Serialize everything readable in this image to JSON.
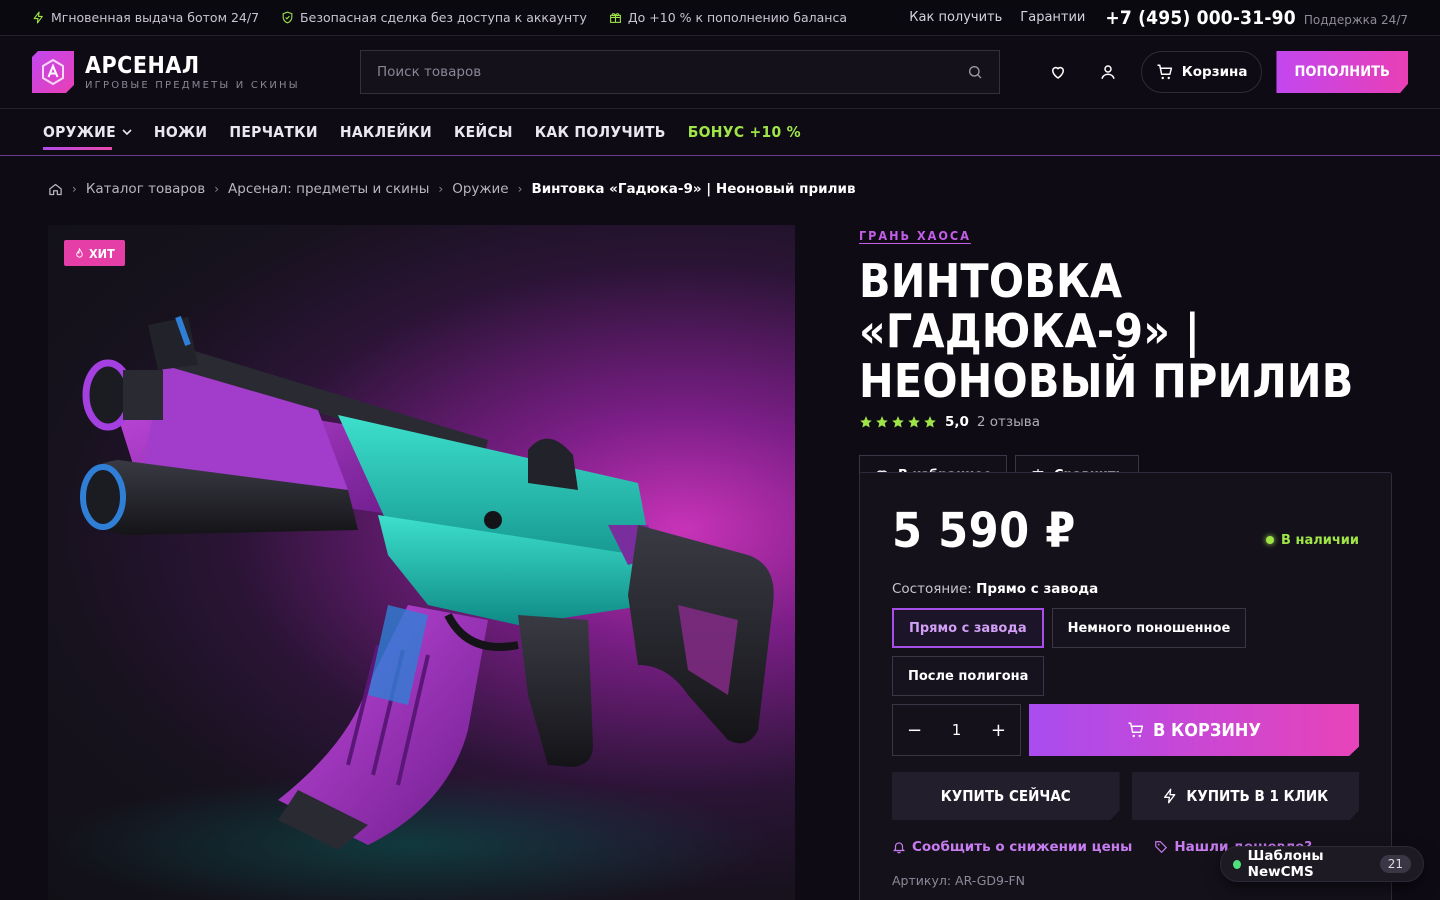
{
  "topbar": {
    "perks": [
      "Мгновенная выдача ботом 24/7",
      "Безопасная сделка без доступа к аккаунту",
      "До +10 % к пополнению баланса"
    ],
    "links": [
      "Как получить",
      "Гарантии"
    ],
    "phone": "+7 (495) 000-31-90",
    "support": "Поддержка 24/7"
  },
  "header": {
    "brand": "АРСЕНАЛ",
    "tagline": "ИГРОВЫЕ ПРЕДМЕТЫ И СКИНЫ",
    "search_placeholder": "Поиск товаров",
    "cart_label": "Корзина",
    "topup_label": "ПОПОЛНИТЬ"
  },
  "nav": {
    "items": [
      "ОРУЖИЕ",
      "НОЖИ",
      "ПЕРЧАТКИ",
      "НАКЛЕЙКИ",
      "КЕЙСЫ",
      "КАК ПОЛУЧИТЬ",
      "БОНУС +10 %"
    ]
  },
  "breadcrumb": [
    "Каталог товаров",
    "Арсенал: предметы и скины",
    "Оружие",
    "Винтовка «Гадюка-9» | Неоновый прилив"
  ],
  "product": {
    "badge": "ХИТ",
    "brand": "ГРАНЬ ХАОСА",
    "title": "ВИНТОВКА «ГАДЮКА-9» | НЕОНОВЫЙ ПРИЛИВ",
    "rating": "5,0",
    "reviews": "2 отзыва",
    "favorite_label": "В избранное",
    "compare_label": "Сравнить",
    "price": "5 590 ₽",
    "stock": "В наличии",
    "condition_label": "Состояние:",
    "condition_value": "Прямо с завода",
    "conditions": [
      "Прямо с завода",
      "Немного поношенное",
      "После полигона"
    ],
    "quantity": "1",
    "add_to_cart": "В КОРЗИНУ",
    "buy_now": "КУПИТЬ СЕЙЧАС",
    "one_click": "КУПИТЬ В 1 КЛИК",
    "price_alert": "Сообщить о снижении цены",
    "found_cheaper": "Нашли дешевле?",
    "sku": "Артикул: AR-GD9-FN"
  },
  "floating": {
    "label": "Шаблоны NewCMS",
    "count": "21"
  },
  "colors": {
    "accent_purple": "#b34be8",
    "accent_pink": "#e843b9",
    "accent_green": "#9fe547",
    "background": "#0e0b14"
  }
}
